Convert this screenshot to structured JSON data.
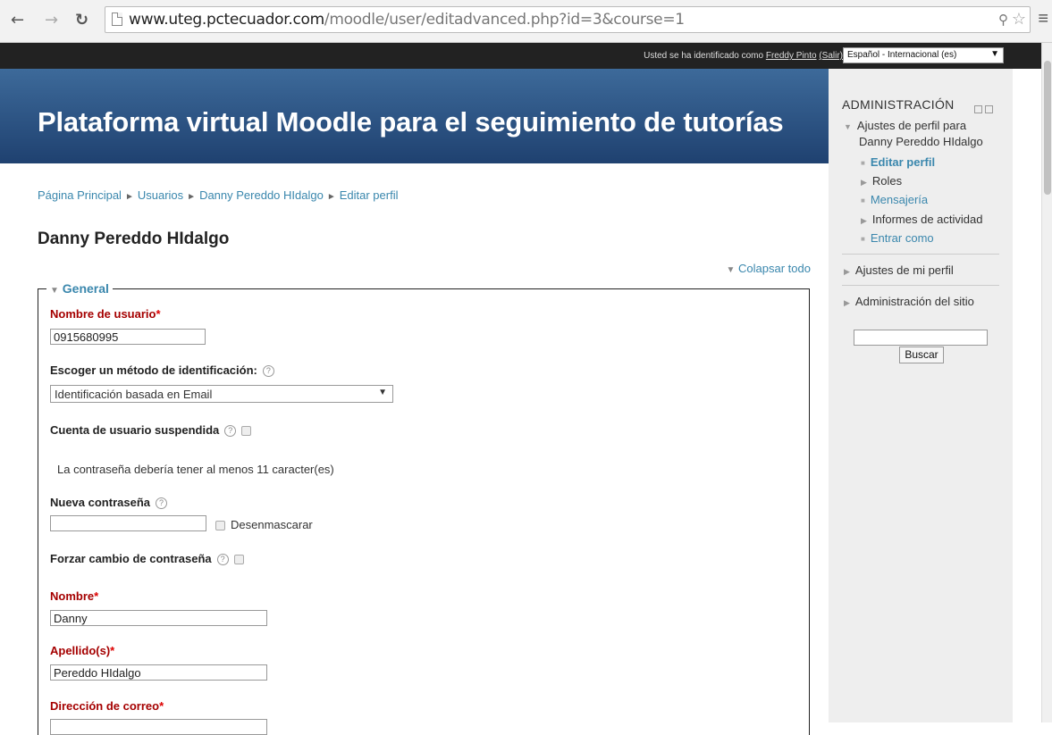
{
  "browser": {
    "url_domain": "www.uteg.pctecuador.com",
    "url_path": "/moodle/user/editadvanced.php?id=3&course=1"
  },
  "topbar": {
    "login_prefix": "Usted se ha identificado como",
    "user_name": "Freddy Pinto",
    "logout": "(Salir)",
    "language": "Español - Internacional (es)"
  },
  "header": {
    "site_title": "Plataforma virtual Moodle para el seguimiento de tutorías"
  },
  "breadcrumb": [
    "Página Principal",
    "Usuarios",
    "Danny Pereddo HIdalgo",
    "Editar perfil"
  ],
  "page_title": "Danny Pereddo HIdalgo",
  "collapse_all": "Colapsar todo",
  "form": {
    "legend": "General",
    "username_label": "Nombre de usuario",
    "username_value": "0915680995",
    "auth_label": "Escoger un método de identificación:",
    "auth_value": "Identificación basada en Email",
    "suspended_label": "Cuenta de usuario suspendida",
    "password_hint": "La contraseña debería tener al menos 11 caracter(es)",
    "new_password_label": "Nueva contraseña",
    "unmask_label": "Desenmascarar",
    "force_change_label": "Forzar cambio de contraseña",
    "firstname_label": "Nombre",
    "firstname_value": "Danny",
    "lastname_label": "Apellido(s)",
    "lastname_value": "Pereddo HIdalgo",
    "email_label": "Dirección de correo",
    "required_marker": "*",
    "help_glyph": "?"
  },
  "sidebar": {
    "title": "ADMINISTRACIÓN",
    "profile_settings": "Ajustes de perfil para",
    "profile_settings_name": "Danny Pereddo HIdalgo",
    "edit_profile": "Editar perfil",
    "roles": "Roles",
    "messaging": "Mensajería",
    "activity_reports": "Informes de actividad",
    "login_as": "Entrar como",
    "my_profile_settings": "Ajustes de mi perfil",
    "site_admin": "Administración del sitio",
    "search_button": "Buscar"
  }
}
